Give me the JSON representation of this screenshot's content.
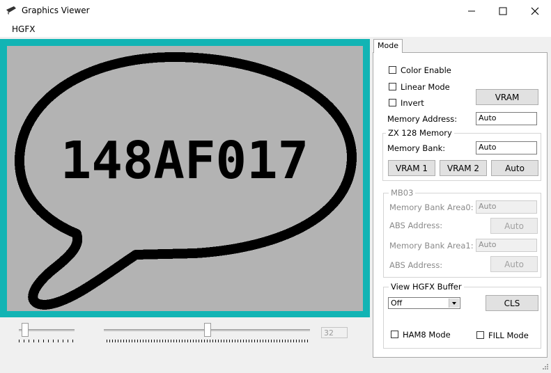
{
  "window": {
    "title": "Graphics Viewer",
    "icon": "app-icon",
    "controls": [
      "minimize-icon",
      "maximize-icon",
      "close-icon"
    ]
  },
  "menu": {
    "items": [
      "HGFX"
    ]
  },
  "canvas": {
    "speech_text": "148AF017",
    "border_color": "#12b4b4",
    "background_color": "#b3b3b3"
  },
  "sliders": {
    "small_value_fraction": 0.1,
    "large_value_fraction": 0.5,
    "value": "32"
  },
  "tab": {
    "label": "Mode"
  },
  "mode": {
    "color_enable": {
      "label": "Color Enable",
      "checked": false
    },
    "linear_mode": {
      "label": "Linear Mode",
      "checked": false
    },
    "invert": {
      "label": "Invert",
      "checked": false
    },
    "vram_button": "VRAM",
    "memory_address_label": "Memory Address:",
    "memory_address_value": "Auto"
  },
  "zx128": {
    "legend": "ZX 128 Memory",
    "memory_bank_label": "Memory Bank:",
    "memory_bank_value": "Auto",
    "buttons": [
      "VRAM 1",
      "VRAM 2",
      "Auto"
    ]
  },
  "mb03": {
    "legend": "MB03",
    "area0_label": "Memory Bank Area0:",
    "area0_value": "Auto",
    "abs1_label": "ABS Address:",
    "abs1_button": "Auto",
    "area1_label": "Memory Bank Area1:",
    "area1_value": "Auto",
    "abs2_label": "ABS Address:",
    "abs2_button": "Auto"
  },
  "hgfx_buffer": {
    "legend": "View HGFX Buffer",
    "select_value": "Off",
    "cls_button": "CLS",
    "ham8": {
      "label": "HAM8 Mode",
      "checked": false
    },
    "fill": {
      "label": "FILL Mode",
      "checked": false
    }
  }
}
